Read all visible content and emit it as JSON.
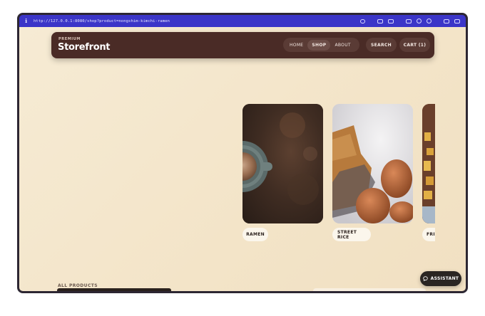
{
  "browser": {
    "info_icon": "info-icon",
    "url": "http://127.0.0.1:8080/shop?product=nongshim-kimchi-ramen",
    "tool_icons": [
      "link-icon",
      "screenshot-icon",
      "camera-icon",
      "window-icon",
      "target-icon",
      "settings-icon",
      "layout-icon",
      "sidebar-icon"
    ]
  },
  "nav": {
    "kicker": "PREMIUM",
    "brand": "Storefront",
    "links": [
      "HOME",
      "SHOP",
      "ABOUT"
    ],
    "active": "SHOP",
    "search_label": "SEARCH",
    "cart_label": "CART (1)"
  },
  "carousel": {
    "items": [
      {
        "label": "RAMEN",
        "image": "coffee-cup-on-rusty-table-photo"
      },
      {
        "label": "STREET RICE",
        "image": "bread-and-eggs-with-flour-photo"
      },
      {
        "label": "FRI",
        "image": "fries-photo"
      }
    ]
  },
  "products": {
    "kicker": "ALL PRODUCTS"
  },
  "assistant": {
    "label": "ASSISTANT",
    "icon": "chat-bubble-icon"
  },
  "colors": {
    "urlbar": "#3b35c8",
    "navbar": "#4a2b26",
    "background": "#f5e8cf",
    "assistant": "#2a2522"
  }
}
